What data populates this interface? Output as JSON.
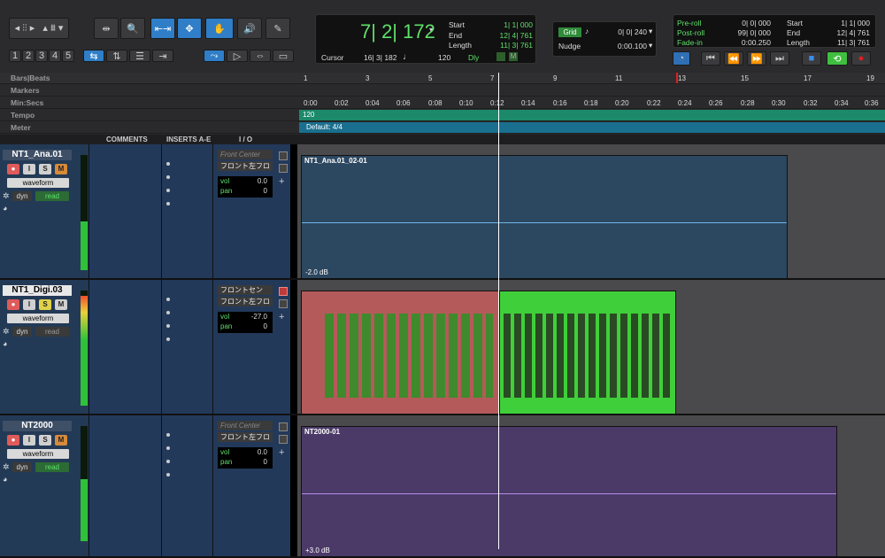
{
  "toolbar": {
    "groups": [
      "1",
      "2",
      "3",
      "4",
      "5"
    ],
    "counter": {
      "main": "7| 2| 172",
      "start": "1| 1| 000",
      "end": "12| 4| 761",
      "length": "11| 3| 761",
      "start_label": "Start",
      "end_label": "End",
      "length_label": "Length",
      "cursor_label": "Cursor",
      "cursor": "16| 3| 182",
      "tempo": "120",
      "dly": "Dly"
    },
    "grid": {
      "label": "Grid",
      "value": "0| 0| 240",
      "nudge_label": "Nudge",
      "nudge": "0:00.100"
    },
    "transport": {
      "preroll_label": "Pre-roll",
      "preroll": "0| 0| 000",
      "postroll_label": "Post-roll",
      "postroll": "99| 0| 000",
      "fadein_label": "Fade-in",
      "fadein": "0:00.250",
      "start_label": "Start",
      "start": "1| 1| 000",
      "end_label": "End",
      "end": "12| 4| 761",
      "length_label": "Length",
      "length": "11| 3| 761"
    }
  },
  "rulers": {
    "bars_label": "Bars|Beats",
    "markers_label": "Markers",
    "minsecs_label": "Min:Secs",
    "tempo_label": "Tempo",
    "meter_label": "Meter",
    "bars": [
      "1",
      "3",
      "5",
      "7",
      "9",
      "11",
      "13",
      "15",
      "17",
      "19"
    ],
    "secs": [
      "0:00",
      "0:02",
      "0:04",
      "0:06",
      "0:08",
      "0:10",
      "0:12",
      "0:14",
      "0:16",
      "0:18",
      "0:20",
      "0:22",
      "0:24",
      "0:26",
      "0:28",
      "0:30",
      "0:32",
      "0:34",
      "0:36"
    ],
    "tempo_value": "120",
    "meter_value": "Default: 4/4"
  },
  "columns": {
    "comments": "COMMENTS",
    "inserts": "INSERTS A-E",
    "io": "I / O"
  },
  "tracks": [
    {
      "name": "NT1_Ana.01",
      "view": "waveform",
      "auto_label": "dyn",
      "auto": "read",
      "io_in": "Front Center",
      "io_out": "フロント左フロ",
      "vol_label": "vol",
      "vol": "0.0",
      "pan_label": "pan",
      "pan": "0",
      "clip": "NT1_Ana.01_02-01",
      "gain": "-2.0 dB",
      "color": "#4a9fd0"
    },
    {
      "name": "NT1_Digi.03",
      "view": "waveform",
      "auto_label": "dyn",
      "auto": "read",
      "io_in": "フロントセン",
      "io_out": "フロント左フロ",
      "vol_label": "vol",
      "vol": "-27.0",
      "pan_label": "pan",
      "pan": "0",
      "clip": "",
      "gain": "",
      "color": "#3fcf3a"
    },
    {
      "name": "NT2000",
      "view": "waveform",
      "auto_label": "dyn",
      "auto": "read",
      "io_in": "Front Center",
      "io_out": "フロント左フロ",
      "vol_label": "vol",
      "vol": "0.0",
      "pan_label": "pan",
      "pan": "0",
      "clip": "NT2000-01",
      "gain": "+3.0 dB",
      "color": "#9b5fd0"
    }
  ],
  "track_buttons": {
    "i": "I",
    "s": "S",
    "m": "M"
  }
}
